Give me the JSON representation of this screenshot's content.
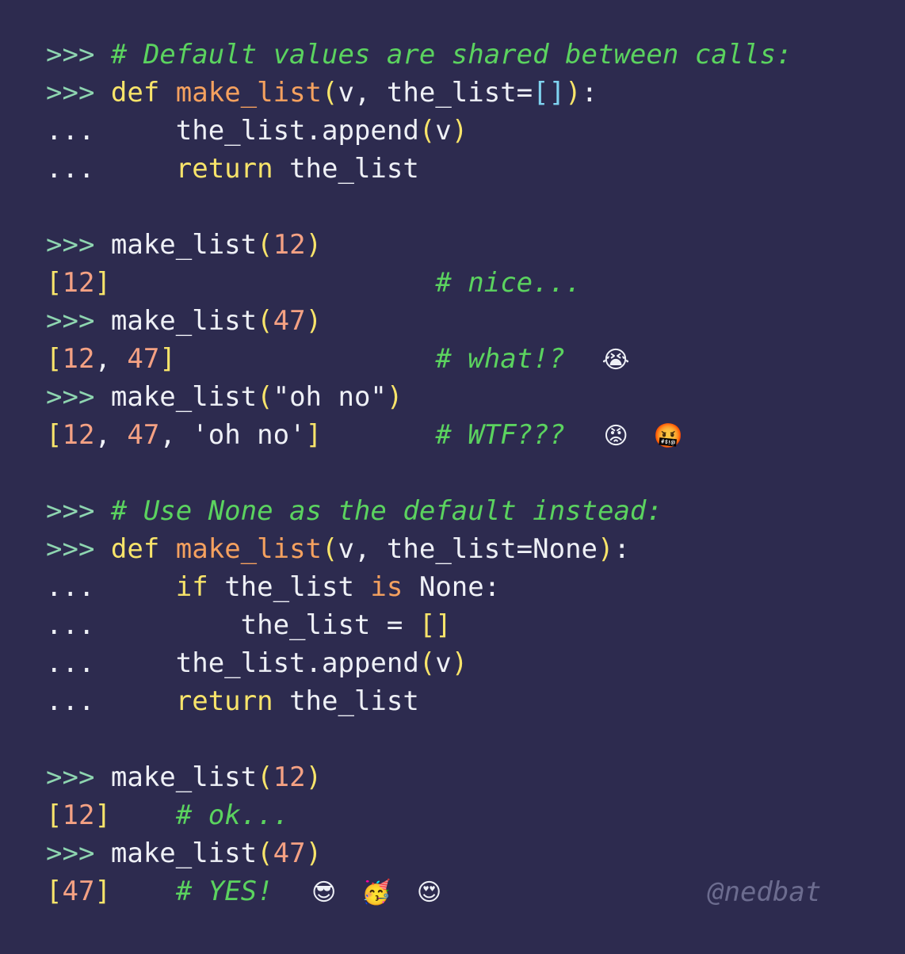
{
  "terminal": {
    "lines": [
      [
        {
          "t": ">>> ",
          "c": "prompt"
        },
        {
          "t": "# Default values are shared between calls:",
          "c": "comment"
        }
      ],
      [
        {
          "t": ">>> ",
          "c": "prompt"
        },
        {
          "t": "def",
          "c": "kw"
        },
        {
          "t": " ",
          "c": "name"
        },
        {
          "t": "make_list",
          "c": "fn"
        },
        {
          "t": "(",
          "c": "bracket"
        },
        {
          "t": "v, the_list=",
          "c": "name"
        },
        {
          "t": "[]",
          "c": "bracket-cyan"
        },
        {
          "t": ")",
          "c": "bracket"
        },
        {
          "t": ":",
          "c": "name"
        }
      ],
      [
        {
          "t": "...     ",
          "c": "name"
        },
        {
          "t": "the_list.append",
          "c": "name"
        },
        {
          "t": "(",
          "c": "bracket"
        },
        {
          "t": "v",
          "c": "name"
        },
        {
          "t": ")",
          "c": "bracket"
        }
      ],
      [
        {
          "t": "...     ",
          "c": "name"
        },
        {
          "t": "return",
          "c": "kw"
        },
        {
          "t": " the_list",
          "c": "name"
        }
      ],
      [],
      [
        {
          "t": ">>> ",
          "c": "prompt"
        },
        {
          "t": "make_list",
          "c": "name"
        },
        {
          "t": "(",
          "c": "bracket"
        },
        {
          "t": "12",
          "c": "num"
        },
        {
          "t": ")",
          "c": "bracket"
        }
      ],
      [
        {
          "t": "[",
          "c": "bracket"
        },
        {
          "t": "12",
          "c": "num"
        },
        {
          "t": "]",
          "c": "bracket"
        },
        {
          "t": "                    ",
          "c": "name"
        },
        {
          "t": "# nice...",
          "c": "comment"
        }
      ],
      [
        {
          "t": ">>> ",
          "c": "prompt"
        },
        {
          "t": "make_list",
          "c": "name"
        },
        {
          "t": "(",
          "c": "bracket"
        },
        {
          "t": "47",
          "c": "num"
        },
        {
          "t": ")",
          "c": "bracket"
        }
      ],
      [
        {
          "t": "[",
          "c": "bracket"
        },
        {
          "t": "12",
          "c": "num"
        },
        {
          "t": ", ",
          "c": "name"
        },
        {
          "t": "47",
          "c": "num"
        },
        {
          "t": "]",
          "c": "bracket"
        },
        {
          "t": "                ",
          "c": "name"
        },
        {
          "t": "# what!?  ",
          "c": "comment"
        },
        {
          "t": "😭",
          "c": "emoji",
          "name": "crying-face-emoji"
        }
      ],
      [
        {
          "t": ">>> ",
          "c": "prompt"
        },
        {
          "t": "make_list",
          "c": "name"
        },
        {
          "t": "(",
          "c": "bracket"
        },
        {
          "t": "\"oh no\"",
          "c": "str"
        },
        {
          "t": ")",
          "c": "bracket"
        }
      ],
      [
        {
          "t": "[",
          "c": "bracket"
        },
        {
          "t": "12",
          "c": "num"
        },
        {
          "t": ", ",
          "c": "name"
        },
        {
          "t": "47",
          "c": "num"
        },
        {
          "t": ", ",
          "c": "name"
        },
        {
          "t": "'oh no'",
          "c": "str"
        },
        {
          "t": "]",
          "c": "bracket"
        },
        {
          "t": "       ",
          "c": "name"
        },
        {
          "t": "# WTF???  ",
          "c": "comment"
        },
        {
          "t": "😡",
          "c": "emoji",
          "name": "angry-face-emoji"
        },
        {
          "t": " ",
          "c": "name"
        },
        {
          "t": "🤬",
          "c": "emoji",
          "name": "cursing-face-emoji"
        }
      ],
      [],
      [
        {
          "t": ">>> ",
          "c": "prompt"
        },
        {
          "t": "# Use None as the default instead:",
          "c": "comment"
        }
      ],
      [
        {
          "t": ">>> ",
          "c": "prompt"
        },
        {
          "t": "def",
          "c": "kw"
        },
        {
          "t": " ",
          "c": "name"
        },
        {
          "t": "make_list",
          "c": "fn"
        },
        {
          "t": "(",
          "c": "bracket"
        },
        {
          "t": "v, the_list=None",
          "c": "name"
        },
        {
          "t": ")",
          "c": "bracket"
        },
        {
          "t": ":",
          "c": "name"
        }
      ],
      [
        {
          "t": "...     ",
          "c": "name"
        },
        {
          "t": "if",
          "c": "kw"
        },
        {
          "t": " the_list ",
          "c": "name"
        },
        {
          "t": "is",
          "c": "kw2"
        },
        {
          "t": " None:",
          "c": "name"
        }
      ],
      [
        {
          "t": "...         ",
          "c": "name"
        },
        {
          "t": "the_list = ",
          "c": "name"
        },
        {
          "t": "[]",
          "c": "bracket"
        }
      ],
      [
        {
          "t": "...     ",
          "c": "name"
        },
        {
          "t": "the_list.append",
          "c": "name"
        },
        {
          "t": "(",
          "c": "bracket"
        },
        {
          "t": "v",
          "c": "name"
        },
        {
          "t": ")",
          "c": "bracket"
        }
      ],
      [
        {
          "t": "...     ",
          "c": "name"
        },
        {
          "t": "return",
          "c": "kw"
        },
        {
          "t": " the_list",
          "c": "name"
        }
      ],
      [],
      [
        {
          "t": ">>> ",
          "c": "prompt"
        },
        {
          "t": "make_list",
          "c": "name"
        },
        {
          "t": "(",
          "c": "bracket"
        },
        {
          "t": "12",
          "c": "num"
        },
        {
          "t": ")",
          "c": "bracket"
        }
      ],
      [
        {
          "t": "[",
          "c": "bracket"
        },
        {
          "t": "12",
          "c": "num"
        },
        {
          "t": "]",
          "c": "bracket"
        },
        {
          "t": "    ",
          "c": "name"
        },
        {
          "t": "# ok...",
          "c": "comment"
        }
      ],
      [
        {
          "t": ">>> ",
          "c": "prompt"
        },
        {
          "t": "make_list",
          "c": "name"
        },
        {
          "t": "(",
          "c": "bracket"
        },
        {
          "t": "47",
          "c": "num"
        },
        {
          "t": ")",
          "c": "bracket"
        }
      ],
      [
        {
          "t": "[",
          "c": "bracket"
        },
        {
          "t": "47",
          "c": "num"
        },
        {
          "t": "]",
          "c": "bracket"
        },
        {
          "t": "    ",
          "c": "name"
        },
        {
          "t": "# YES!  ",
          "c": "comment"
        },
        {
          "t": "😎",
          "c": "emoji",
          "name": "sunglasses-face-emoji"
        },
        {
          "t": " ",
          "c": "name"
        },
        {
          "t": "🥳",
          "c": "emoji",
          "name": "party-face-emoji"
        },
        {
          "t": " ",
          "c": "name"
        },
        {
          "t": "😍",
          "c": "emoji",
          "name": "heart-eyes-face-emoji"
        }
      ]
    ]
  },
  "watermark": "@nedbat",
  "colors": {
    "background": "#2d2b4f",
    "prompt": "#8ed5b0",
    "keyword": "#f8e46a",
    "function": "#f5a15f",
    "number": "#f4a183",
    "comment": "#5bd35f",
    "text": "#eef0f6",
    "watermark": "#6c6c8f"
  }
}
